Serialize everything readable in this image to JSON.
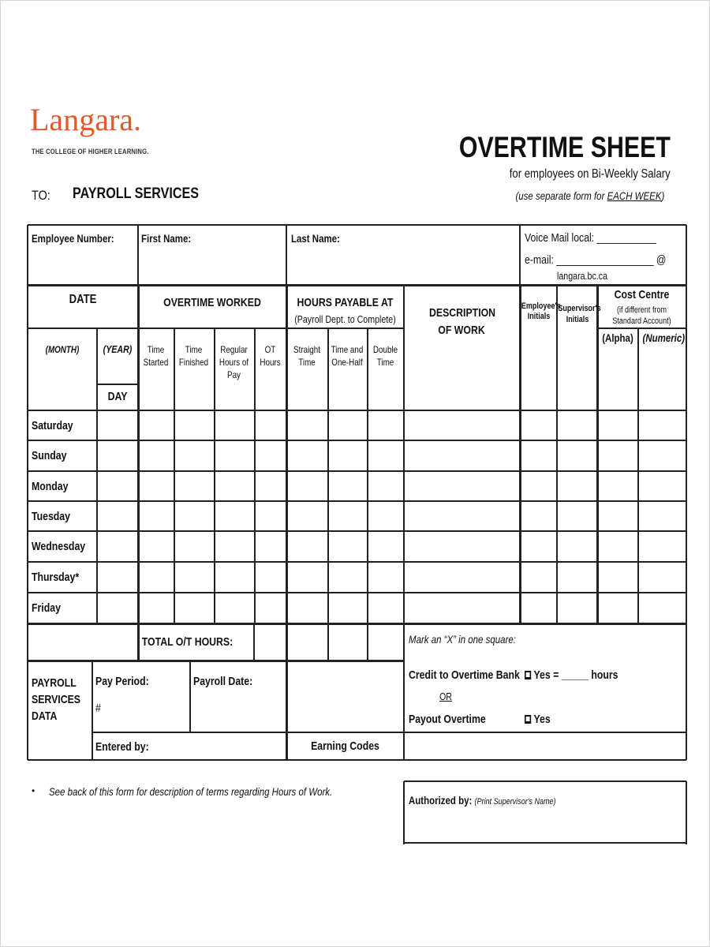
{
  "header": {
    "logo_text": "Langara.",
    "tagline": "THE COLLEGE OF HIGHER LEARNING.",
    "to_label": "TO:",
    "to_value": "PAYROLL SERVICES",
    "title": "OVERTIME SHEET",
    "subtitle": "for employees on Bi-Weekly Salary",
    "note_prefix": "(use separate form for ",
    "note_emphasis": "EACH WEEK",
    "note_suffix": ")",
    "brand_color": "#e05a2b"
  },
  "employee": {
    "number_label": "Employee Number:",
    "first_name_label": "First Name:",
    "last_name_label": "Last Name:",
    "voicemail_label": "Voice Mail local: ___________",
    "email_label": "e-mail: __________________ @",
    "email_domain": "langara.bc.ca"
  },
  "table": {
    "date_header": "DATE",
    "overtime_header": "OVERTIME WORKED",
    "hours_payable_header": "HOURS PAYABLE AT",
    "hours_payable_note": "(Payroll Dept. to Complete)",
    "description_header": "DESCRIPTION OF WORK",
    "employee_initials": "Employee's Initials",
    "supervisor_initials": "Supervisor's Initials",
    "cost_centre_header": "Cost Centre",
    "cost_centre_note": "(if different from Standard Account)",
    "alpha": "(Alpha)",
    "numeric": "(Numeric)",
    "month": "(MONTH)",
    "year": "(YEAR)",
    "day": "DAY",
    "columns": [
      "Time Started",
      "Time Finished",
      "Regular Hours of Pay",
      "OT Hours",
      "Straight Time",
      "Time and One-Half",
      "Double Time"
    ],
    "days": [
      "Saturday",
      "Sunday",
      "Monday",
      "Tuesday",
      "Wednesday",
      "Thursday*",
      "Friday"
    ],
    "total_label": "TOTAL O/T HOURS:"
  },
  "payroll": {
    "label": "PAYROLL SERVICES DATA",
    "pay_period_label": "Pay Period:",
    "pay_period_hash": "#",
    "payroll_date_label": "Payroll Date:",
    "entered_by_label": "Entered by:",
    "earning_codes_label": "Earning Codes"
  },
  "options": {
    "instruction": "Mark an “X” in one square:",
    "credit_label": "Credit to Overtime Bank",
    "credit_yes": "Yes  =  _____ hours",
    "or_label": "OR",
    "payout_label": "Payout Overtime",
    "payout_yes": "Yes"
  },
  "footer": {
    "bullet_note": "See back of this form for description of terms regarding Hours of Work.",
    "authorized_label": "Authorized by:",
    "authorized_note": "(Print Supervisor's Name)"
  }
}
